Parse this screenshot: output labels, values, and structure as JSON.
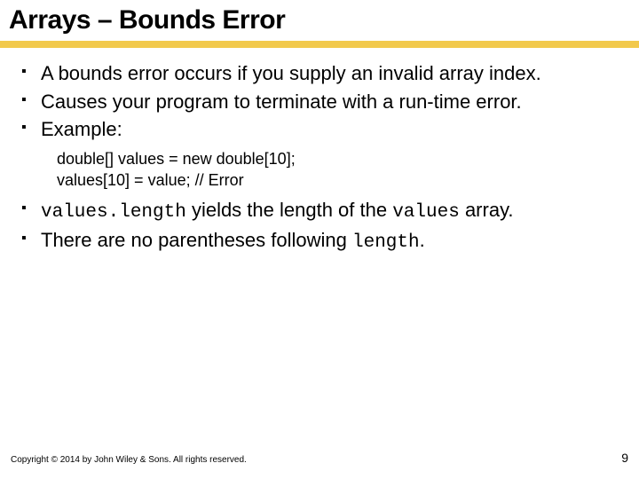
{
  "title": "Arrays – Bounds Error",
  "bullets_a": [
    "A bounds error occurs if you supply an invalid array index.",
    "Causes your program to terminate with a run-time error.",
    "Example:"
  ],
  "code": {
    "line1": "double[] values = new double[10];",
    "line2": "values[10] = value; // Error"
  },
  "bullets_b": {
    "b4_pre": "values.length",
    "b4_mid": " yields the length of the ",
    "b4_code": "values",
    "b4_post": " array.",
    "b5_pre": "There are no parentheses following ",
    "b5_code": "length",
    "b5_post": "."
  },
  "footer": {
    "copyright": "Copyright © 2014 by John Wiley & Sons. All rights reserved.",
    "page": "9"
  }
}
